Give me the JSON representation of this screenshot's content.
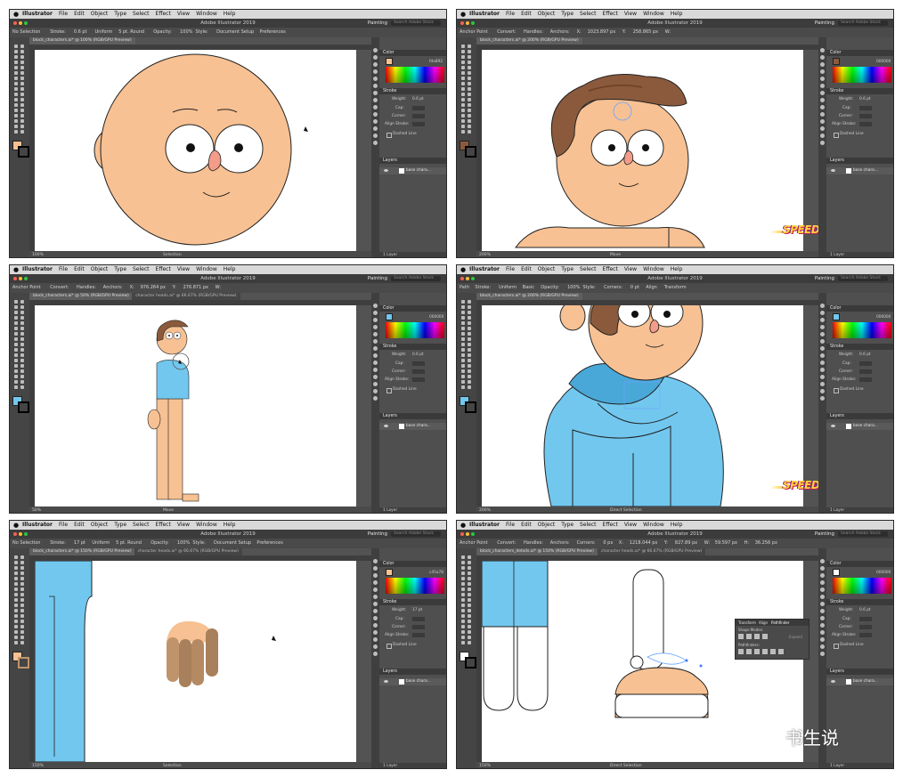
{
  "menubar": {
    "apple": "",
    "items": [
      "Illustrator",
      "File",
      "Edit",
      "Object",
      "Type",
      "Select",
      "Effect",
      "View",
      "Window",
      "Help"
    ]
  },
  "app_title": "Adobe Illustrator 2019",
  "workspace": "Painting",
  "search_placeholder": "Search Adobe Stock",
  "panels": {
    "color_title": "Color",
    "stroke_title": "Stroke",
    "weight_label": "Weight:",
    "cap_label": "Cap:",
    "corner_label": "Corner:",
    "align_label": "Align Stroke:",
    "dashed_label": "Dashed Line",
    "layers_title": "Layers",
    "layer_name": "base chara...",
    "layer_count": "1 Layer"
  },
  "speed_badge": "SPEED MODE 2X",
  "watermark": "书生说",
  "panes": [
    {
      "control": [
        "No Selection",
        "Stroke:",
        "0.6 pt",
        "Uniform",
        "5 pt. Round",
        "Opacity:",
        "100%",
        "Style:",
        "Document Setup",
        "Preferences"
      ],
      "tabs": [
        "block_characters.ai* @ 100% (RGB/GPU Preview)"
      ],
      "hex": "fda892",
      "weight": "0.6 pt",
      "zoom": "100%",
      "status_tool": "Selection",
      "fill_color": "#f7c193",
      "stroke_color": "#000000"
    },
    {
      "control": [
        "Anchor Point",
        "Convert:",
        "Handles:",
        "Anchors:",
        "X:",
        "1023.897 px",
        "Y:",
        "258.865 px",
        "W:"
      ],
      "tabs": [
        "block_characters.ai* @ 200% (RGB/GPU Preview)"
      ],
      "hex": "000000",
      "weight": "0.6 pt",
      "zoom": "200%",
      "status_tool": "Move",
      "fill_color": "#8b5a3c",
      "stroke_color": "#000000"
    },
    {
      "control": [
        "Anchor Point",
        "Convert:",
        "Handles:",
        "Anchors:",
        "X:",
        "976.264 px",
        "Y:",
        "276.871 px",
        "W:"
      ],
      "tabs": [
        "block_characters.ai* @ 50% (RGB/GPU Preview)",
        "character heads.ai* @ 66.67% (RGB/GPU Preview)"
      ],
      "hex": "000000",
      "weight": "0.6 pt",
      "zoom": "50%",
      "status_tool": "Move",
      "fill_color": "#72c7ee",
      "stroke_color": "#000000"
    },
    {
      "control": [
        "Path",
        "Stroke:",
        "Uniform",
        "Basic",
        "Opacity:",
        "100%",
        "Style:",
        "Corners:",
        "0 pt",
        "Align",
        "Transform"
      ],
      "tabs": [
        "block_characters.ai* @ 200% (RGB/GPU Preview)"
      ],
      "hex": "000000",
      "weight": "0.6 pt",
      "zoom": "200%",
      "status_tool": "Direct Selection",
      "fill_color": "#72c7ee",
      "stroke_color": "#000000"
    },
    {
      "control": [
        "No Selection",
        "Stroke:",
        "17 pt",
        "Uniform",
        "5 pt. Round",
        "Opacity:",
        "100%",
        "Style:",
        "Document Setup",
        "Preferences"
      ],
      "tabs": [
        "block_characters.ai* @ 150% (RGB/GPU Preview)",
        "character heads.ai* @ 66.67% (RGB/GPU Preview)"
      ],
      "hex": "c45a78",
      "weight": "17 pt",
      "zoom": "150%",
      "status_tool": "Selection",
      "fill_color": "#f7c193",
      "stroke_color": "#c0946a"
    },
    {
      "control": [
        "Anchor Point",
        "Convert:",
        "Handles:",
        "Anchors:",
        "Corners:",
        "0 px",
        "X:",
        "1218.044 px",
        "Y:",
        "827.89 px",
        "W:",
        "59.597 px",
        "H:",
        "36.256 px"
      ],
      "tabs": [
        "block_characters_details.ai* @ 150% (RGB/GPU Preview)",
        "character heads.ai* @ 66.67% (RGB/GPU Preview)"
      ],
      "hex": "000000",
      "weight": "0.6 pt",
      "zoom": "150%",
      "status_tool": "Direct Selection",
      "fill_color": "#ffffff",
      "stroke_color": "#000000",
      "pathfinder": {
        "tabs": [
          "Transform",
          "Align",
          "Pathfinder"
        ],
        "shape_modes": "Shape Modes:",
        "pathfinders": "Pathfinders:",
        "expand": "Expand"
      }
    }
  ]
}
